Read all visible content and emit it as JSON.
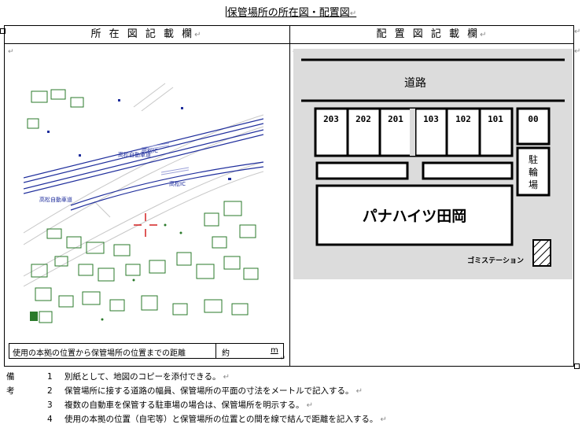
{
  "page_title": "保管場所の所在図・配置図",
  "left_header": "所 在 図 記 載 欄",
  "right_header": "配 置 図 記 載 欄",
  "map": {
    "road_label_1": "高松自動車道",
    "road_label_2": "高松自動車道",
    "ic_label_1": "高松IC",
    "ic_label_2": "高松IC"
  },
  "distance_row": {
    "label": "使用の本拠の位置から保管場所の位置までの距離",
    "approx": "約",
    "unit": "m"
  },
  "layout": {
    "road": "道路",
    "top_units": [
      "203",
      "202",
      "201",
      "103",
      "102",
      "101"
    ],
    "corner_unit": "00",
    "bicycle_parking": "駐輪場",
    "building": "パナハイツ田岡",
    "garbage_station": "ゴミステーション"
  },
  "notes": {
    "label": "備考",
    "items": [
      {
        "num": "1",
        "text": "別紙として、地図のコピーを添付できる。"
      },
      {
        "num": "2",
        "text": "保管場所に接する道路の幅員、保管場所の平面の寸法をメートルで記入する。"
      },
      {
        "num": "3",
        "text": "複数の自動車を保管する駐車場の場合は、保管場所を明示する。"
      },
      {
        "num": "4",
        "text": "使用の本拠の位置（自宅等）と保管場所の位置との間を線で結んで距離を記入する。"
      }
    ]
  }
}
